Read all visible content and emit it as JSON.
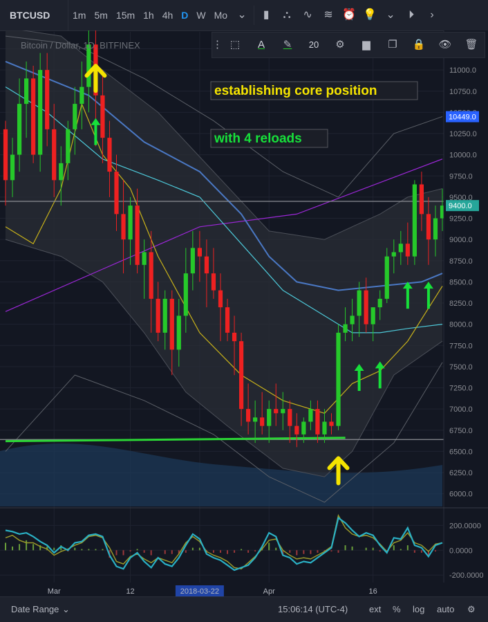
{
  "toolbar": {
    "symbol": "BTCUSD",
    "intervals": [
      "1m",
      "5m",
      "15m",
      "1h",
      "4h",
      "D",
      "W",
      "Mo"
    ],
    "active_interval": "D"
  },
  "drawing_toolbar": {
    "line_size": "20"
  },
  "legend": {
    "title": "Bitcoin / Dollar, 1D, BITFINEX"
  },
  "annotations": {
    "text1": "establishing core position",
    "text2": "with 4 reloads"
  },
  "colors": {
    "background": "#131722",
    "up": "#26c92a",
    "down": "#ee2121",
    "annotation_yellow": "#f5e400",
    "annotation_green": "#17e03a",
    "sma_purple": "#9c27d8",
    "ema_blue": "#4a78c4",
    "ema_cyan": "#4dc9d9",
    "ema_yellow": "#c8b21a",
    "osc_cyan": "#2ab0c4",
    "osc_olive": "#9a9a2a"
  },
  "bottom": {
    "date_range": "Date Range",
    "time": "15:06:14 (UTC-4)",
    "ext": "ext",
    "percent": "%",
    "log": "log",
    "auto": "auto"
  },
  "chart_data": {
    "type": "candlestick",
    "title": "Bitcoin / Dollar, 1D, BITFINEX",
    "price_axis": {
      "ylim": [
        5850,
        11450
      ],
      "ticks": [
        6000,
        6250,
        6500,
        6750,
        7000,
        7250,
        7500,
        7750,
        8000,
        8250,
        8500,
        8750,
        9000,
        9250,
        9500,
        9750,
        10000,
        10250,
        10500,
        10750,
        11000,
        11250
      ],
      "tick_labels": [
        "6000.0",
        "6250.0",
        "6500.0",
        "6750.0",
        "7000.0",
        "7250.0",
        "7500.0",
        "7750.0",
        "8000.0",
        "8250.0",
        "8500.0",
        "8750.0",
        "9000.0",
        "9250.0",
        "9500.0",
        "9750.0",
        "10000.0",
        "10250.0",
        "10500.0",
        "10750.0",
        "11000.0",
        "11250.0"
      ],
      "badges": [
        {
          "value": 10449,
          "label": "10449.0",
          "color": "#2962ff"
        },
        {
          "value": 9400,
          "label": "9400.0",
          "color": "#26a69a"
        }
      ]
    },
    "x_axis": {
      "labels": [
        {
          "text": "Mar",
          "bar": 7
        },
        {
          "text": "12",
          "bar": 18
        },
        {
          "text": "2018-03-22",
          "bar": 28,
          "highlight": true
        },
        {
          "text": "Apr",
          "bar": 38
        },
        {
          "text": "16",
          "bar": 53
        }
      ]
    },
    "candles": [
      [
        10300,
        10400,
        9400,
        9700
      ],
      [
        9700,
        10200,
        9500,
        10000
      ],
      [
        10000,
        10900,
        9800,
        10600
      ],
      [
        10600,
        11100,
        10200,
        10900
      ],
      [
        10900,
        11050,
        9900,
        10000
      ],
      [
        10000,
        11200,
        9800,
        11000
      ],
      [
        11000,
        11200,
        10100,
        10300
      ],
      [
        10300,
        10600,
        9500,
        9700
      ],
      [
        9700,
        10100,
        9400,
        9900
      ],
      [
        9900,
        10400,
        9700,
        10300
      ],
      [
        10300,
        10800,
        10000,
        10600
      ],
      [
        10600,
        11100,
        10300,
        10800
      ],
      [
        10800,
        11500,
        10500,
        11300
      ],
      [
        11300,
        11500,
        10100,
        10700
      ],
      [
        10700,
        11000,
        9900,
        10200
      ],
      [
        10200,
        10400,
        9500,
        9800
      ],
      [
        9800,
        10000,
        9100,
        9300
      ],
      [
        9300,
        9700,
        8600,
        9000
      ],
      [
        9000,
        9500,
        8700,
        9400
      ],
      [
        9400,
        9600,
        8600,
        8700
      ],
      [
        8700,
        9000,
        8300,
        8850
      ],
      [
        8850,
        9100,
        7900,
        8300
      ],
      [
        8300,
        8500,
        7800,
        7900
      ],
      [
        7900,
        8400,
        7700,
        8300
      ],
      [
        8300,
        8400,
        7400,
        7700
      ],
      [
        7700,
        8300,
        7500,
        8100
      ],
      [
        8100,
        8900,
        7900,
        8600
      ],
      [
        8600,
        9100,
        8400,
        8900
      ],
      [
        8900,
        9100,
        8500,
        8800
      ],
      [
        8800,
        9000,
        8200,
        8600
      ],
      [
        8600,
        8900,
        8300,
        8400
      ],
      [
        8400,
        8600,
        7800,
        8200
      ],
      [
        8200,
        8300,
        7800,
        7900
      ],
      [
        7900,
        8100,
        7400,
        7800
      ],
      [
        7800,
        7900,
        6800,
        7000
      ],
      [
        7000,
        7300,
        6700,
        6850
      ],
      [
        6850,
        7100,
        6600,
        6900
      ],
      [
        6900,
        7200,
        6700,
        6800
      ],
      [
        6800,
        7100,
        6600,
        7000
      ],
      [
        7000,
        7300,
        6800,
        6950
      ],
      [
        6950,
        7200,
        6750,
        7000
      ],
      [
        7000,
        7100,
        6600,
        6800
      ],
      [
        6800,
        6950,
        6550,
        6700
      ],
      [
        6700,
        6900,
        6600,
        6850
      ],
      [
        6850,
        7100,
        6750,
        7000
      ],
      [
        7000,
        7100,
        6600,
        6700
      ],
      [
        6700,
        7000,
        6600,
        6850
      ],
      [
        6850,
        6950,
        6700,
        6800
      ],
      [
        6800,
        8000,
        6750,
        7900
      ],
      [
        7900,
        8200,
        7800,
        8000
      ],
      [
        8000,
        8300,
        7800,
        8100
      ],
      [
        8100,
        8500,
        7850,
        8400
      ],
      [
        8400,
        8550,
        7900,
        8000
      ],
      [
        8000,
        8200,
        7800,
        8200
      ],
      [
        8200,
        8400,
        8050,
        8300
      ],
      [
        8300,
        8900,
        8250,
        8800
      ],
      [
        8800,
        9000,
        8600,
        8850
      ],
      [
        8850,
        9100,
        8700,
        8950
      ],
      [
        8950,
        9200,
        8700,
        8800
      ],
      [
        8800,
        9700,
        8700,
        9650
      ],
      [
        9650,
        9800,
        9100,
        9300
      ],
      [
        9300,
        9500,
        8700,
        9000
      ],
      [
        9000,
        9400,
        8800,
        9250
      ],
      [
        9250,
        9600,
        9100,
        9400
      ]
    ],
    "indicators": {
      "sma_purple": [
        [
          0,
          8150
        ],
        [
          14,
          8650
        ],
        [
          28,
          9150
        ],
        [
          42,
          9300
        ],
        [
          63,
          9950
        ]
      ],
      "ema_blue": [
        [
          0,
          11100
        ],
        [
          6,
          10900
        ],
        [
          12,
          10700
        ],
        [
          20,
          10150
        ],
        [
          28,
          9800
        ],
        [
          34,
          9300
        ],
        [
          38,
          8800
        ],
        [
          42,
          8500
        ],
        [
          48,
          8400
        ],
        [
          54,
          8450
        ],
        [
          60,
          8500
        ],
        [
          63,
          8600
        ]
      ],
      "ema_cyan": [
        [
          0,
          10800
        ],
        [
          6,
          10500
        ],
        [
          14,
          9950
        ],
        [
          22,
          9700
        ],
        [
          28,
          9500
        ],
        [
          34,
          8950
        ],
        [
          40,
          8400
        ],
        [
          46,
          8100
        ],
        [
          50,
          7900
        ],
        [
          54,
          7900
        ],
        [
          58,
          7950
        ],
        [
          63,
          8000
        ]
      ],
      "ema_yellow": [
        [
          0,
          9150
        ],
        [
          4,
          8950
        ],
        [
          8,
          9600
        ],
        [
          11,
          10600
        ],
        [
          14,
          10000
        ],
        [
          18,
          9600
        ],
        [
          22,
          8800
        ],
        [
          28,
          7900
        ],
        [
          34,
          7400
        ],
        [
          40,
          7100
        ],
        [
          46,
          6950
        ],
        [
          50,
          7300
        ],
        [
          54,
          7450
        ],
        [
          58,
          7800
        ],
        [
          63,
          8450
        ]
      ],
      "bb_upper": [
        [
          0,
          11500
        ],
        [
          8,
          11400
        ],
        [
          14,
          11000
        ],
        [
          22,
          10500
        ],
        [
          30,
          9800
        ],
        [
          38,
          9100
        ],
        [
          46,
          9000
        ],
        [
          54,
          9300
        ],
        [
          58,
          9500
        ],
        [
          63,
          9600
        ]
      ],
      "bb_lower": [
        [
          0,
          9000
        ],
        [
          8,
          8800
        ],
        [
          14,
          8500
        ],
        [
          20,
          7900
        ],
        [
          26,
          7200
        ],
        [
          32,
          6800
        ],
        [
          40,
          6300
        ],
        [
          46,
          6200
        ],
        [
          50,
          6500
        ],
        [
          56,
          7400
        ],
        [
          63,
          7800
        ]
      ],
      "gray_upper": [
        [
          0,
          11400
        ],
        [
          10,
          11300
        ],
        [
          20,
          10900
        ],
        [
          30,
          10400
        ],
        [
          40,
          9800
        ],
        [
          48,
          9500
        ],
        [
          56,
          10250
        ],
        [
          63,
          10450
        ]
      ],
      "gray_lower": [
        [
          0,
          6500
        ],
        [
          10,
          7400
        ],
        [
          20,
          7100
        ],
        [
          30,
          6700
        ],
        [
          38,
          6200
        ],
        [
          46,
          5900
        ],
        [
          56,
          6600
        ],
        [
          63,
          7550
        ]
      ]
    },
    "horizontal_lines": [
      {
        "value": 9450,
        "color": "#8d8f95"
      },
      {
        "value": 6640,
        "color": "#8d8f95"
      }
    ],
    "support_line": {
      "from": [
        0,
        6620
      ],
      "to": [
        49,
        6660
      ],
      "color": "#2bd635"
    },
    "arrows": [
      {
        "type": "up",
        "color": "yellow",
        "bar": 13,
        "value": 10950
      },
      {
        "type": "up",
        "color": "green",
        "bar": 13,
        "value": 10350
      },
      {
        "type": "up",
        "color": "yellow",
        "bar": 48,
        "value": 6320
      },
      {
        "type": "up",
        "color": "green",
        "bar": 51,
        "value": 7450
      },
      {
        "type": "up",
        "color": "green",
        "bar": 54,
        "value": 7480
      },
      {
        "type": "up",
        "color": "green",
        "bar": 58,
        "value": 8420
      },
      {
        "type": "up",
        "color": "green",
        "bar": 61,
        "value": 8420
      }
    ],
    "oscillator": {
      "ylim": [
        -260,
        330
      ],
      "ticks": [
        -200,
        0,
        200
      ],
      "tick_labels": [
        "-200.0000",
        "0.0000",
        "200.0000"
      ],
      "line_a": [
        160,
        150,
        130,
        140,
        110,
        70,
        40,
        -20,
        30,
        0,
        60,
        70,
        120,
        130,
        110,
        -40,
        -130,
        -150,
        -60,
        -20,
        -90,
        -140,
        -60,
        -110,
        -130,
        -60,
        40,
        130,
        90,
        -30,
        -60,
        -80,
        -120,
        -160,
        -140,
        -120,
        -60,
        30,
        140,
        110,
        -40,
        -60,
        -110,
        -90,
        -100,
        -60,
        -20,
        20,
        260,
        220,
        160,
        110,
        140,
        120,
        40,
        -20,
        100,
        90,
        180,
        40,
        20,
        -50,
        40,
        60
      ],
      "line_b": [
        100,
        120,
        80,
        60,
        60,
        30,
        10,
        -40,
        -10,
        10,
        40,
        60,
        110,
        120,
        100,
        20,
        -90,
        -110,
        -50,
        -30,
        -70,
        -100,
        -60,
        -80,
        -100,
        -30,
        60,
        110,
        70,
        -10,
        -40,
        -60,
        -90,
        -140,
        -150,
        -100,
        -50,
        10,
        80,
        90,
        0,
        -40,
        -70,
        -60,
        -70,
        -40,
        -10,
        30,
        280,
        180,
        130,
        110,
        120,
        100,
        50,
        -10,
        60,
        80,
        140,
        60,
        40,
        -10,
        50,
        60
      ]
    }
  }
}
